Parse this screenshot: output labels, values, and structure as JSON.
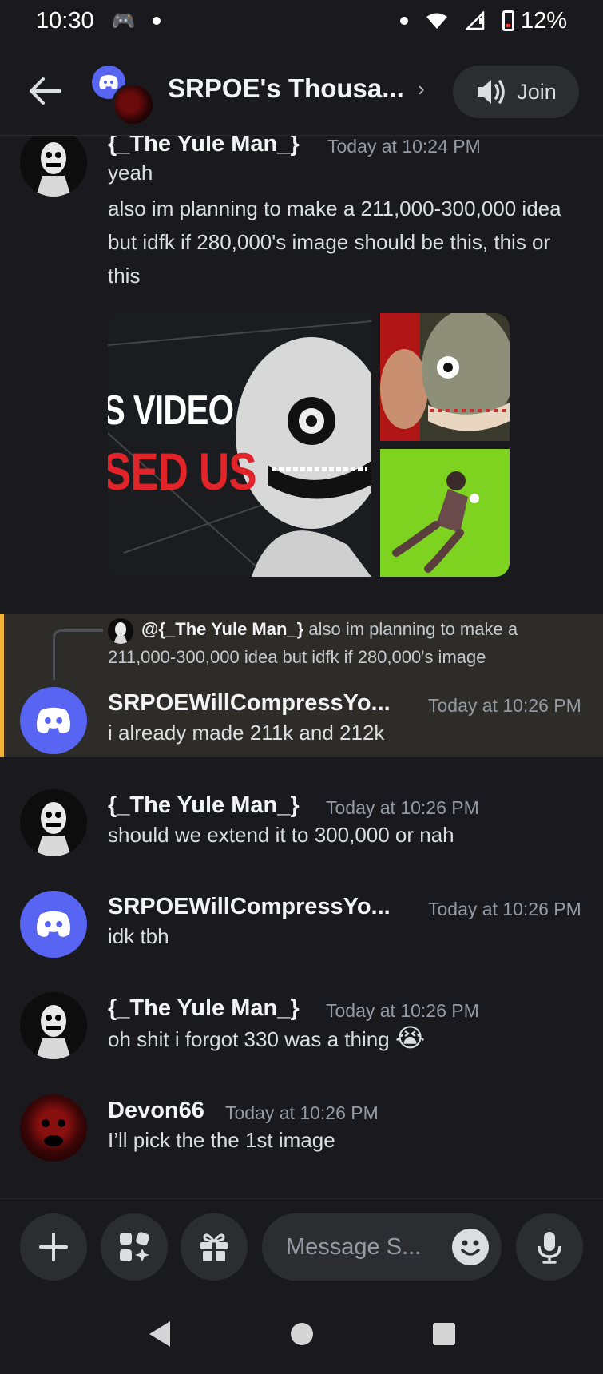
{
  "status_bar": {
    "time": "10:30",
    "battery": "12%"
  },
  "header": {
    "back_icon": "arrow-left-icon",
    "channel_title": "SRPOE's Thousa...",
    "chevron": "›",
    "join_label": "Join"
  },
  "messages": [
    {
      "author": "{_The Yule Man_}",
      "time": "Today at 10:24 PM",
      "lines": [
        "yeah",
        "also im planning to make a 211,000-300,000 idea but idfk if 280,000's image should be this, this or this"
      ],
      "images": [
        {
          "text_line1": "S VIDEO",
          "text_line2": "SED US"
        },
        {},
        {}
      ]
    },
    {
      "reply_author": "@{_The Yule Man_}",
      "reply_text": "also im planning to make a 211,000-300,000 idea but idfk if 280,000's image",
      "author": "SRPOEWillCompressYo...",
      "time": "Today at 10:26 PM",
      "text": "i already made 211k and 212k"
    },
    {
      "author": "{_The Yule Man_}",
      "time": "Today at 10:26 PM",
      "text": "should we extend it to 300,000 or nah"
    },
    {
      "author": "SRPOEWillCompressYo...",
      "time": "Today at 10:26 PM",
      "text": "idk tbh"
    },
    {
      "author": "{_The Yule Man_}",
      "time": "Today at 10:26 PM",
      "text": "oh shit i forgot 330 was a thing",
      "emoji": "😭"
    },
    {
      "author": "Devon66",
      "time": "Today at 10:26 PM",
      "text": "I’ll pick the the 1st image"
    }
  ],
  "composer": {
    "placeholder": "Message S..."
  },
  "colors": {
    "accent": "#5865f2",
    "highlight_bar": "#f0b232",
    "background": "#1a1a1e"
  }
}
